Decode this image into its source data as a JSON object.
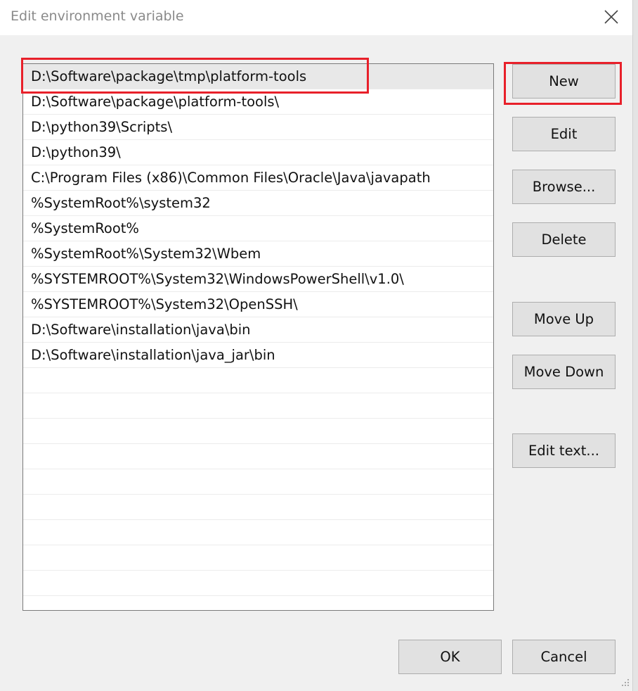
{
  "window": {
    "title": "Edit environment variable",
    "close_icon": "close-icon"
  },
  "path_entries": [
    "D:\\Software\\package\\tmp\\platform-tools",
    "D:\\Software\\package\\platform-tools\\",
    "D:\\python39\\Scripts\\",
    "D:\\python39\\",
    "C:\\Program Files (x86)\\Common Files\\Oracle\\Java\\javapath",
    "%SystemRoot%\\system32",
    "%SystemRoot%",
    "%SystemRoot%\\System32\\Wbem",
    "%SYSTEMROOT%\\System32\\WindowsPowerShell\\v1.0\\",
    "%SYSTEMROOT%\\System32\\OpenSSH\\",
    "D:\\Software\\installation\\java\\bin",
    "D:\\Software\\installation\\java_jar\\bin",
    "",
    "",
    "",
    "",
    "",
    "",
    "",
    "",
    ""
  ],
  "buttons": {
    "new": "New",
    "edit": "Edit",
    "browse": "Browse...",
    "delete": "Delete",
    "move_up": "Move Up",
    "move_down": "Move Down",
    "edit_text": "Edit text...",
    "ok": "OK",
    "cancel": "Cancel"
  },
  "colors": {
    "highlight_annotation": "#e8202a",
    "selected_row": "#e8e8e8"
  }
}
